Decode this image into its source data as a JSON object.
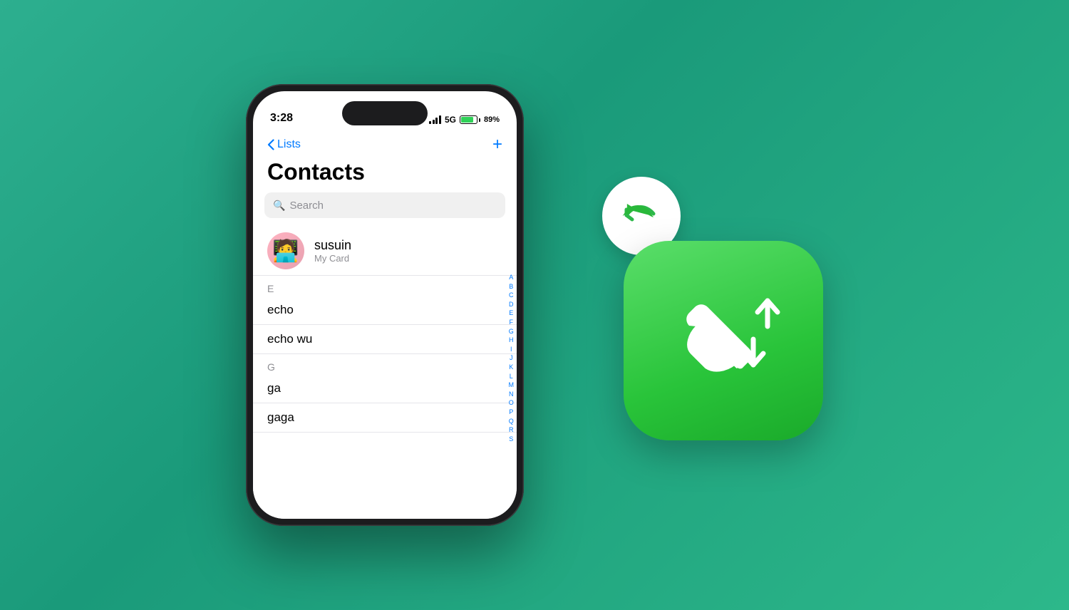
{
  "background": {
    "gradient_start": "#2daf8f",
    "gradient_end": "#1a9a7a"
  },
  "phone": {
    "status_bar": {
      "time": "3:28",
      "signal": "5G",
      "battery_percent": "89%"
    },
    "nav": {
      "back_label": "Lists",
      "add_label": "+"
    },
    "title": "Contacts",
    "search": {
      "placeholder": "Search"
    },
    "my_card": {
      "name": "susuin",
      "label": "My Card"
    },
    "sections": [
      {
        "letter": "E",
        "contacts": [
          "echo",
          "echo wu"
        ]
      },
      {
        "letter": "G",
        "contacts": [
          "ga",
          "gaga"
        ]
      }
    ],
    "alphabet": [
      "A",
      "B",
      "C",
      "D",
      "E",
      "F",
      "G",
      "H",
      "I",
      "J",
      "K",
      "L",
      "M",
      "N",
      "O",
      "P",
      "Q",
      "R",
      "S"
    ]
  },
  "app_icon": {
    "alt": "Contacts call sync app icon"
  },
  "reply_badge": {
    "alt": "Reply arrow badge"
  }
}
